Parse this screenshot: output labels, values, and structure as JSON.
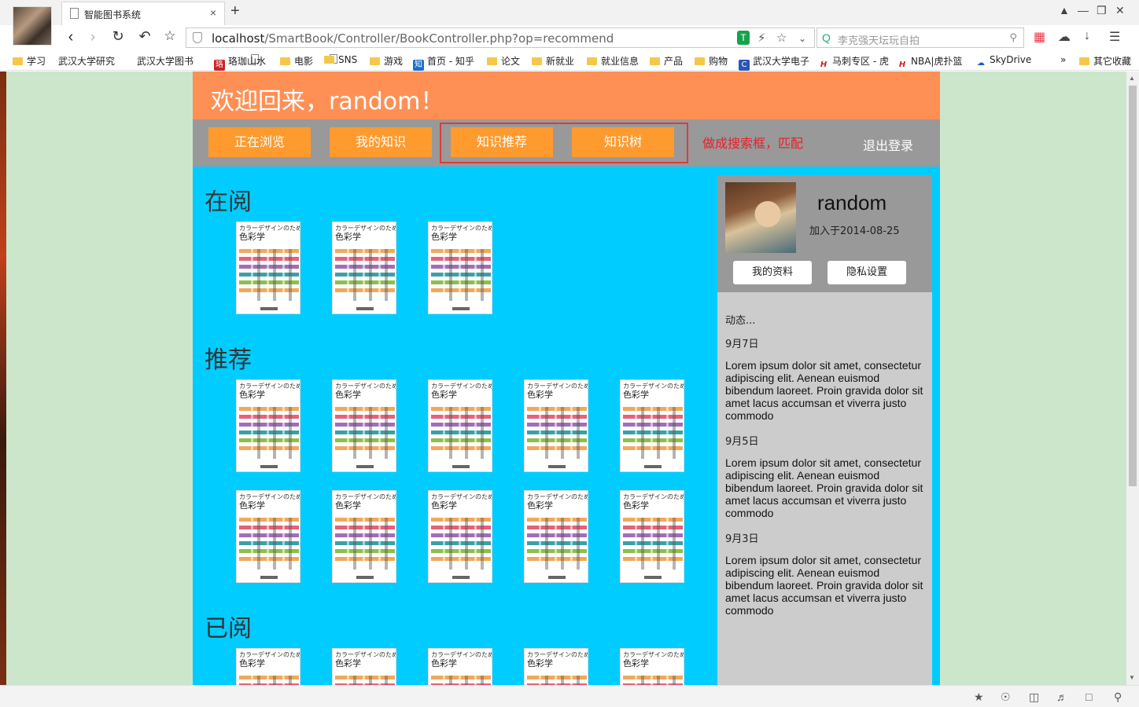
{
  "browser": {
    "tab_title": "智能图书系统",
    "tab_close": "×",
    "new_tab": "+",
    "url_host": "localhost",
    "url_path": "/SmartBook/Controller/BookController.php?op=recommend",
    "search_placeholder": "李克强天坛玩自拍",
    "bookmarks": [
      {
        "label": "学习",
        "kind": "folder"
      },
      {
        "label": "武汉大学研究",
        "kind": "page"
      },
      {
        "label": "武汉大学图书",
        "kind": "page"
      },
      {
        "label": "珞珈山水",
        "kind": "fav"
      },
      {
        "label": "电影",
        "kind": "folder"
      },
      {
        "label": "SNS",
        "kind": "folder"
      },
      {
        "label": "游戏",
        "kind": "folder"
      },
      {
        "label": "首页 - 知乎",
        "kind": "fav"
      },
      {
        "label": "论文",
        "kind": "folder"
      },
      {
        "label": "新就业",
        "kind": "folder"
      },
      {
        "label": "就业信息",
        "kind": "folder"
      },
      {
        "label": "产品",
        "kind": "folder"
      },
      {
        "label": "购物",
        "kind": "folder"
      },
      {
        "label": "武汉大学电子",
        "kind": "fav"
      },
      {
        "label": "马刺专区 - 虎",
        "kind": "fav"
      },
      {
        "label": "NBA|虎扑篮",
        "kind": "fav"
      },
      {
        "label": "SkyDrive",
        "kind": "fav"
      }
    ],
    "bookmarks_more": "»",
    "other_bookmarks": "其它收藏"
  },
  "header": {
    "welcome": "欢迎回来，random！"
  },
  "nav": {
    "browsing": "正在浏览",
    "my_knowledge": "我的知识",
    "recommend": "知识推荐",
    "knowledge_tree": "知识树",
    "annotation": "做成搜索框，匹配",
    "logout": "退出登录"
  },
  "sections": {
    "reading": "在阅",
    "recommended": "推荐",
    "read": "已阅"
  },
  "book": {
    "jp_title": "カラーデザインのための",
    "title": "色彩学",
    "stripe_colors": [
      "#f2a85a",
      "#e8607a",
      "#a46cb8",
      "#3aa0a8",
      "#8cc04a",
      "#f2a85a"
    ]
  },
  "profile": {
    "username": "random",
    "joined": "加入于2014-08-25",
    "my_profile_btn": "我的资料",
    "privacy_btn": "隐私设置"
  },
  "feed": {
    "title": "动态...",
    "entries": [
      {
        "date": "9月7日",
        "text": "Lorem ipsum dolor sit amet, consectetur adipiscing elit. Aenean euismod bibendum laoreet. Proin gravida dolor sit amet lacus accumsan et viverra justo commodo"
      },
      {
        "date": "9月5日",
        "text": "Lorem ipsum dolor sit amet, consectetur adipiscing elit. Aenean euismod bibendum laoreet. Proin gravida dolor sit amet lacus accumsan et viverra justo commodo"
      },
      {
        "date": "9月3日",
        "text": "Lorem ipsum dolor sit amet, consectetur adipiscing elit. Aenean euismod bibendum laoreet. Proin gravida dolor sit amet lacus accumsan et viverra justo commodo"
      }
    ]
  },
  "colors": {
    "header": "#ff9055",
    "navbar": "#999999",
    "nav_button": "#ff9a2e",
    "content": "#00ccff",
    "page_bg": "#cce6cc",
    "annotation": "#e03a3a"
  }
}
